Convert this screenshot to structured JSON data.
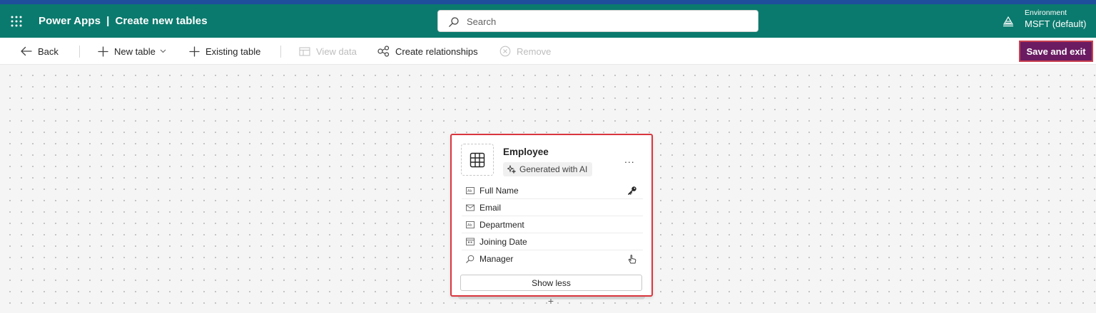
{
  "header": {
    "app_name": "Power Apps",
    "separator": "|",
    "page_title": "Create new tables",
    "search_placeholder": "Search",
    "environment_label": "Environment",
    "environment_value": "MSFT (default)"
  },
  "toolbar": {
    "back_label": "Back",
    "new_table_label": "New table",
    "existing_table_label": "Existing table",
    "view_data_label": "View data",
    "create_relationships_label": "Create relationships",
    "remove_label": "Remove",
    "save_exit_label": "Save and exit"
  },
  "table_card": {
    "title": "Employee",
    "badge": "Generated with AI",
    "more_label": "...",
    "columns": [
      {
        "name": "Full Name",
        "icon": "text-field-icon",
        "right_icon": "key-icon"
      },
      {
        "name": "Email",
        "icon": "mail-icon",
        "right_icon": ""
      },
      {
        "name": "Department",
        "icon": "text-field-icon",
        "right_icon": ""
      },
      {
        "name": "Joining Date",
        "icon": "calendar-icon",
        "right_icon": ""
      },
      {
        "name": "Manager",
        "icon": "lookup-icon",
        "right_icon": "hand-pointer-icon"
      }
    ],
    "show_less_label": "Show less",
    "add_label": "+"
  },
  "colors": {
    "header_bg": "#0b7a6e",
    "save_button_bg": "#6a1b62",
    "highlight_border": "#d9363e"
  }
}
